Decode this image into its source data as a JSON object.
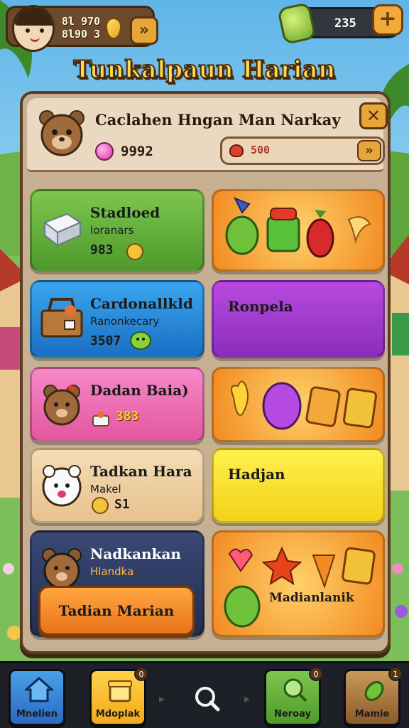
{
  "header": {
    "currency_text": "8l 970\n8l90 3",
    "cash_value": "235",
    "swap_label": "»",
    "plus_label": "+"
  },
  "title": "Tunkalpaun Harian",
  "panel": {
    "header_title": "Caclahen Hngan Man Narkay",
    "gem_count": "9992",
    "progress_text": "500",
    "close_label": "✕",
    "progress_arrow": "»"
  },
  "cards": [
    {
      "title": "Stadloed",
      "sub": "loranars",
      "value": "983"
    },
    {
      "title": "Cardonallkld",
      "sub": "Ranonkecary",
      "value": "3507"
    },
    {
      "title": "Dadan Baia)",
      "sub": "",
      "value": "383"
    },
    {
      "title": "Tadkan Hara",
      "sub": "Makel",
      "value": "S1"
    },
    {
      "title": "Nadkankan",
      "sub": "Hlandka",
      "value": ""
    }
  ],
  "right_cards": {
    "purple_title": "Ronpela",
    "yellow_title": "Hadjan",
    "bottom_label": "Madianlanik"
  },
  "cta_label": "Tadian Marian",
  "nav": [
    {
      "label": "Mnelien",
      "badge": ""
    },
    {
      "label": "Mdoplak",
      "badge": "0"
    },
    {
      "label": "",
      "badge": ""
    },
    {
      "label": "Neroay",
      "badge": "0"
    },
    {
      "label": "Mamie",
      "badge": "1"
    }
  ],
  "colors": {
    "title": "#ffd94a",
    "panel": "#c6b091",
    "green_card": "#7cc64f",
    "blue_card": "#3aa6ee",
    "pink_card": "#f789c8",
    "purple_card": "#b84ae0",
    "yellow_card": "#fff04a",
    "orange_card": "#f28a22"
  }
}
